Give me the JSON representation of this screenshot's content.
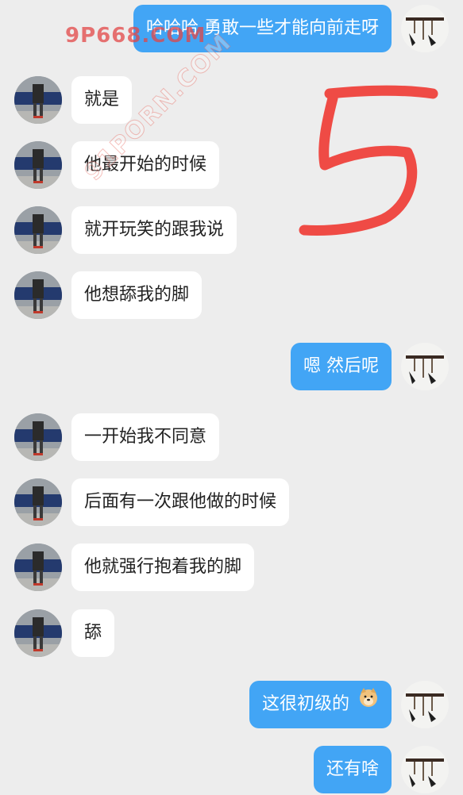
{
  "watermarks": {
    "top": "9P668.COM",
    "diagonal": "91PORN.COM"
  },
  "scribble": "5",
  "messages": [
    {
      "side": "right",
      "text": "哈哈哈 勇敢一些才能向前走呀"
    },
    {
      "side": "left",
      "text": "就是"
    },
    {
      "side": "left",
      "text": "他最开始的时候"
    },
    {
      "side": "left",
      "text": "就开玩笑的跟我说"
    },
    {
      "side": "left",
      "text": "他想舔我的脚"
    },
    {
      "side": "right",
      "text": "嗯 然后呢"
    },
    {
      "side": "left",
      "text": "一开始我不同意"
    },
    {
      "side": "left",
      "text": "后面有一次跟他做的时候"
    },
    {
      "side": "left",
      "text": "他就强行抱着我的脚"
    },
    {
      "side": "left",
      "text": "舔"
    },
    {
      "side": "right",
      "text": "这很初级的",
      "emoji": "doge-emoji"
    },
    {
      "side": "right",
      "text": "还有啥"
    }
  ],
  "colors": {
    "background": "#ededed",
    "sent_bubble": "#42a5f5",
    "received_bubble": "#ffffff",
    "scribble": "#ef4b45"
  }
}
